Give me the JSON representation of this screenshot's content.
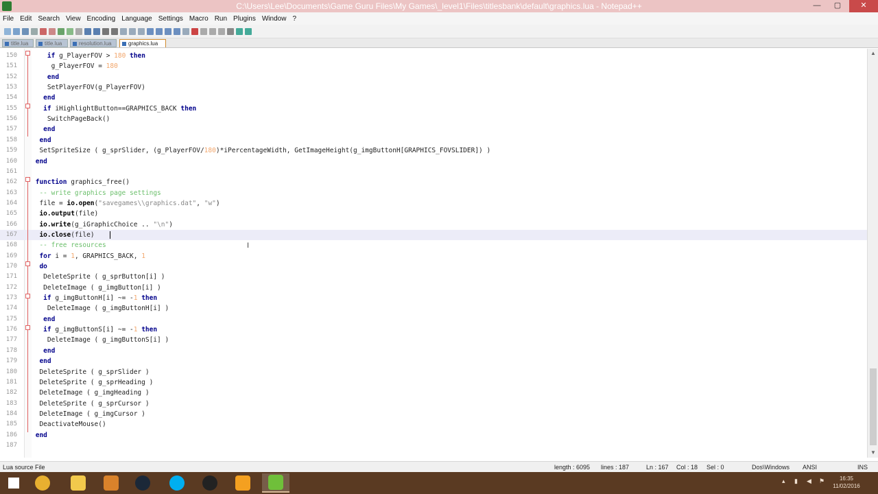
{
  "window": {
    "title": "C:\\Users\\Lee\\Documents\\Game Guru Files\\My Games\\_level1\\Files\\titlesbank\\default\\graphics.lua - Notepad++",
    "minimize": "—",
    "maximize": "▢",
    "close": "✕"
  },
  "menu": [
    "File",
    "Edit",
    "Search",
    "View",
    "Encoding",
    "Language",
    "Settings",
    "Macro",
    "Run",
    "Plugins",
    "Window",
    "?"
  ],
  "tabs": [
    {
      "label": "title.lua",
      "active": false
    },
    {
      "label": "title.lua",
      "active": false
    },
    {
      "label": "resolution.lua",
      "active": false
    },
    {
      "label": "graphics.lua",
      "active": true
    }
  ],
  "lines": [
    {
      "n": "150",
      "html": "    <span class=\"kw\">if</span> g_PlayerFOV &gt; <span class=\"num\">180</span> <span class=\"kw\">then</span>"
    },
    {
      "n": "151",
      "html": "     g_PlayerFOV = <span class=\"num\">180</span>"
    },
    {
      "n": "152",
      "html": "    <span class=\"kw\">end</span>"
    },
    {
      "n": "153",
      "html": "    SetPlayerFOV(g_PlayerFOV)"
    },
    {
      "n": "154",
      "html": "   <span class=\"kw\">end</span>"
    },
    {
      "n": "155",
      "html": "   <span class=\"kw\">if</span> iHighlightButton==GRAPHICS_BACK <span class=\"kw\">then</span>"
    },
    {
      "n": "156",
      "html": "    SwitchPageBack()"
    },
    {
      "n": "157",
      "html": "   <span class=\"kw\">end</span>"
    },
    {
      "n": "158",
      "html": "  <span class=\"kw\">end</span>"
    },
    {
      "n": "159",
      "html": "  SetSpriteSize ( g_sprSlider, (g_PlayerFOV/<span class=\"num\">180</span>)*iPercentageWidth, GetImageHeight(g_imgButtonH[GRAPHICS_FOVSLIDER]) )"
    },
    {
      "n": "160",
      "html": " <span class=\"kw\">end</span>"
    },
    {
      "n": "161",
      "html": ""
    },
    {
      "n": "162",
      "html": " <span class=\"kw\">function</span> graphics_free()"
    },
    {
      "n": "163",
      "html": "  <span class=\"cmt\">-- write graphics page settings</span>"
    },
    {
      "n": "164",
      "html": "  file = <span class=\"fn\">io.open</span>(<span class=\"str\">\"savegames\\\\graphics.dat\"</span>, <span class=\"str\">\"w\"</span>)"
    },
    {
      "n": "165",
      "html": "  <span class=\"fn\">io.output</span>(file)"
    },
    {
      "n": "166",
      "html": "  <span class=\"fn\">io.write</span>(g_iGraphicChoice .. <span class=\"str\">\"\\n\"</span>)"
    },
    {
      "n": "167",
      "html": "  <span class=\"fn\">io.close</span>(file)",
      "current": true
    },
    {
      "n": "168",
      "html": "  <span class=\"cmt\">-- free resources</span>"
    },
    {
      "n": "169",
      "html": "  <span class=\"kw\">for</span> i = <span class=\"num\">1</span>, GRAPHICS_BACK, <span class=\"num\">1</span>"
    },
    {
      "n": "170",
      "html": "  <span class=\"kw\">do</span>"
    },
    {
      "n": "171",
      "html": "   DeleteSprite ( g_sprButton[i] )"
    },
    {
      "n": "172",
      "html": "   DeleteImage ( g_imgButton[i] )"
    },
    {
      "n": "173",
      "html": "   <span class=\"kw\">if</span> g_imgButtonH[i] ~= -<span class=\"num\">1</span> <span class=\"kw\">then</span>"
    },
    {
      "n": "174",
      "html": "    DeleteImage ( g_imgButtonH[i] )"
    },
    {
      "n": "175",
      "html": "   <span class=\"kw\">end</span>"
    },
    {
      "n": "176",
      "html": "   <span class=\"kw\">if</span> g_imgButtonS[i] ~= -<span class=\"num\">1</span> <span class=\"kw\">then</span>"
    },
    {
      "n": "177",
      "html": "    DeleteImage ( g_imgButtonS[i] )"
    },
    {
      "n": "178",
      "html": "   <span class=\"kw\">end</span>"
    },
    {
      "n": "179",
      "html": "  <span class=\"kw\">end</span>"
    },
    {
      "n": "180",
      "html": "  DeleteSprite ( g_sprSlider )"
    },
    {
      "n": "181",
      "html": "  DeleteSprite ( g_sprHeading )"
    },
    {
      "n": "182",
      "html": "  DeleteImage ( g_imgHeading )"
    },
    {
      "n": "183",
      "html": "  DeleteSprite ( g_sprCursor )"
    },
    {
      "n": "184",
      "html": "  DeleteImage ( g_imgCursor )"
    },
    {
      "n": "185",
      "html": "  DeactivateMouse()"
    },
    {
      "n": "186",
      "html": " <span class=\"kw\">end</span>"
    },
    {
      "n": "187",
      "html": ""
    }
  ],
  "status": {
    "file_type": "Lua source File",
    "length": "length : 6095",
    "lines": "lines : 187",
    "ln": "Ln : 167",
    "col": "Col : 18",
    "sel": "Sel : 0",
    "eol": "Dos\\Windows",
    "encoding": "ANSI",
    "mode": "INS"
  },
  "taskbar": {
    "apps": [
      {
        "name": "windows-start",
        "color": "#ffffff"
      },
      {
        "name": "chrome",
        "color": "#e8b030"
      },
      {
        "name": "file-explorer",
        "color": "#f2c94c"
      },
      {
        "name": "paint",
        "color": "#d9822b"
      },
      {
        "name": "steam",
        "color": "#1b2838"
      },
      {
        "name": "skype",
        "color": "#00aff0"
      },
      {
        "name": "obs",
        "color": "#222222"
      },
      {
        "name": "media-player",
        "color": "#f4a020"
      },
      {
        "name": "notepad-plus-plus",
        "color": "#6fbf3a"
      }
    ],
    "time": "16:35",
    "date": "11/02/2016"
  }
}
